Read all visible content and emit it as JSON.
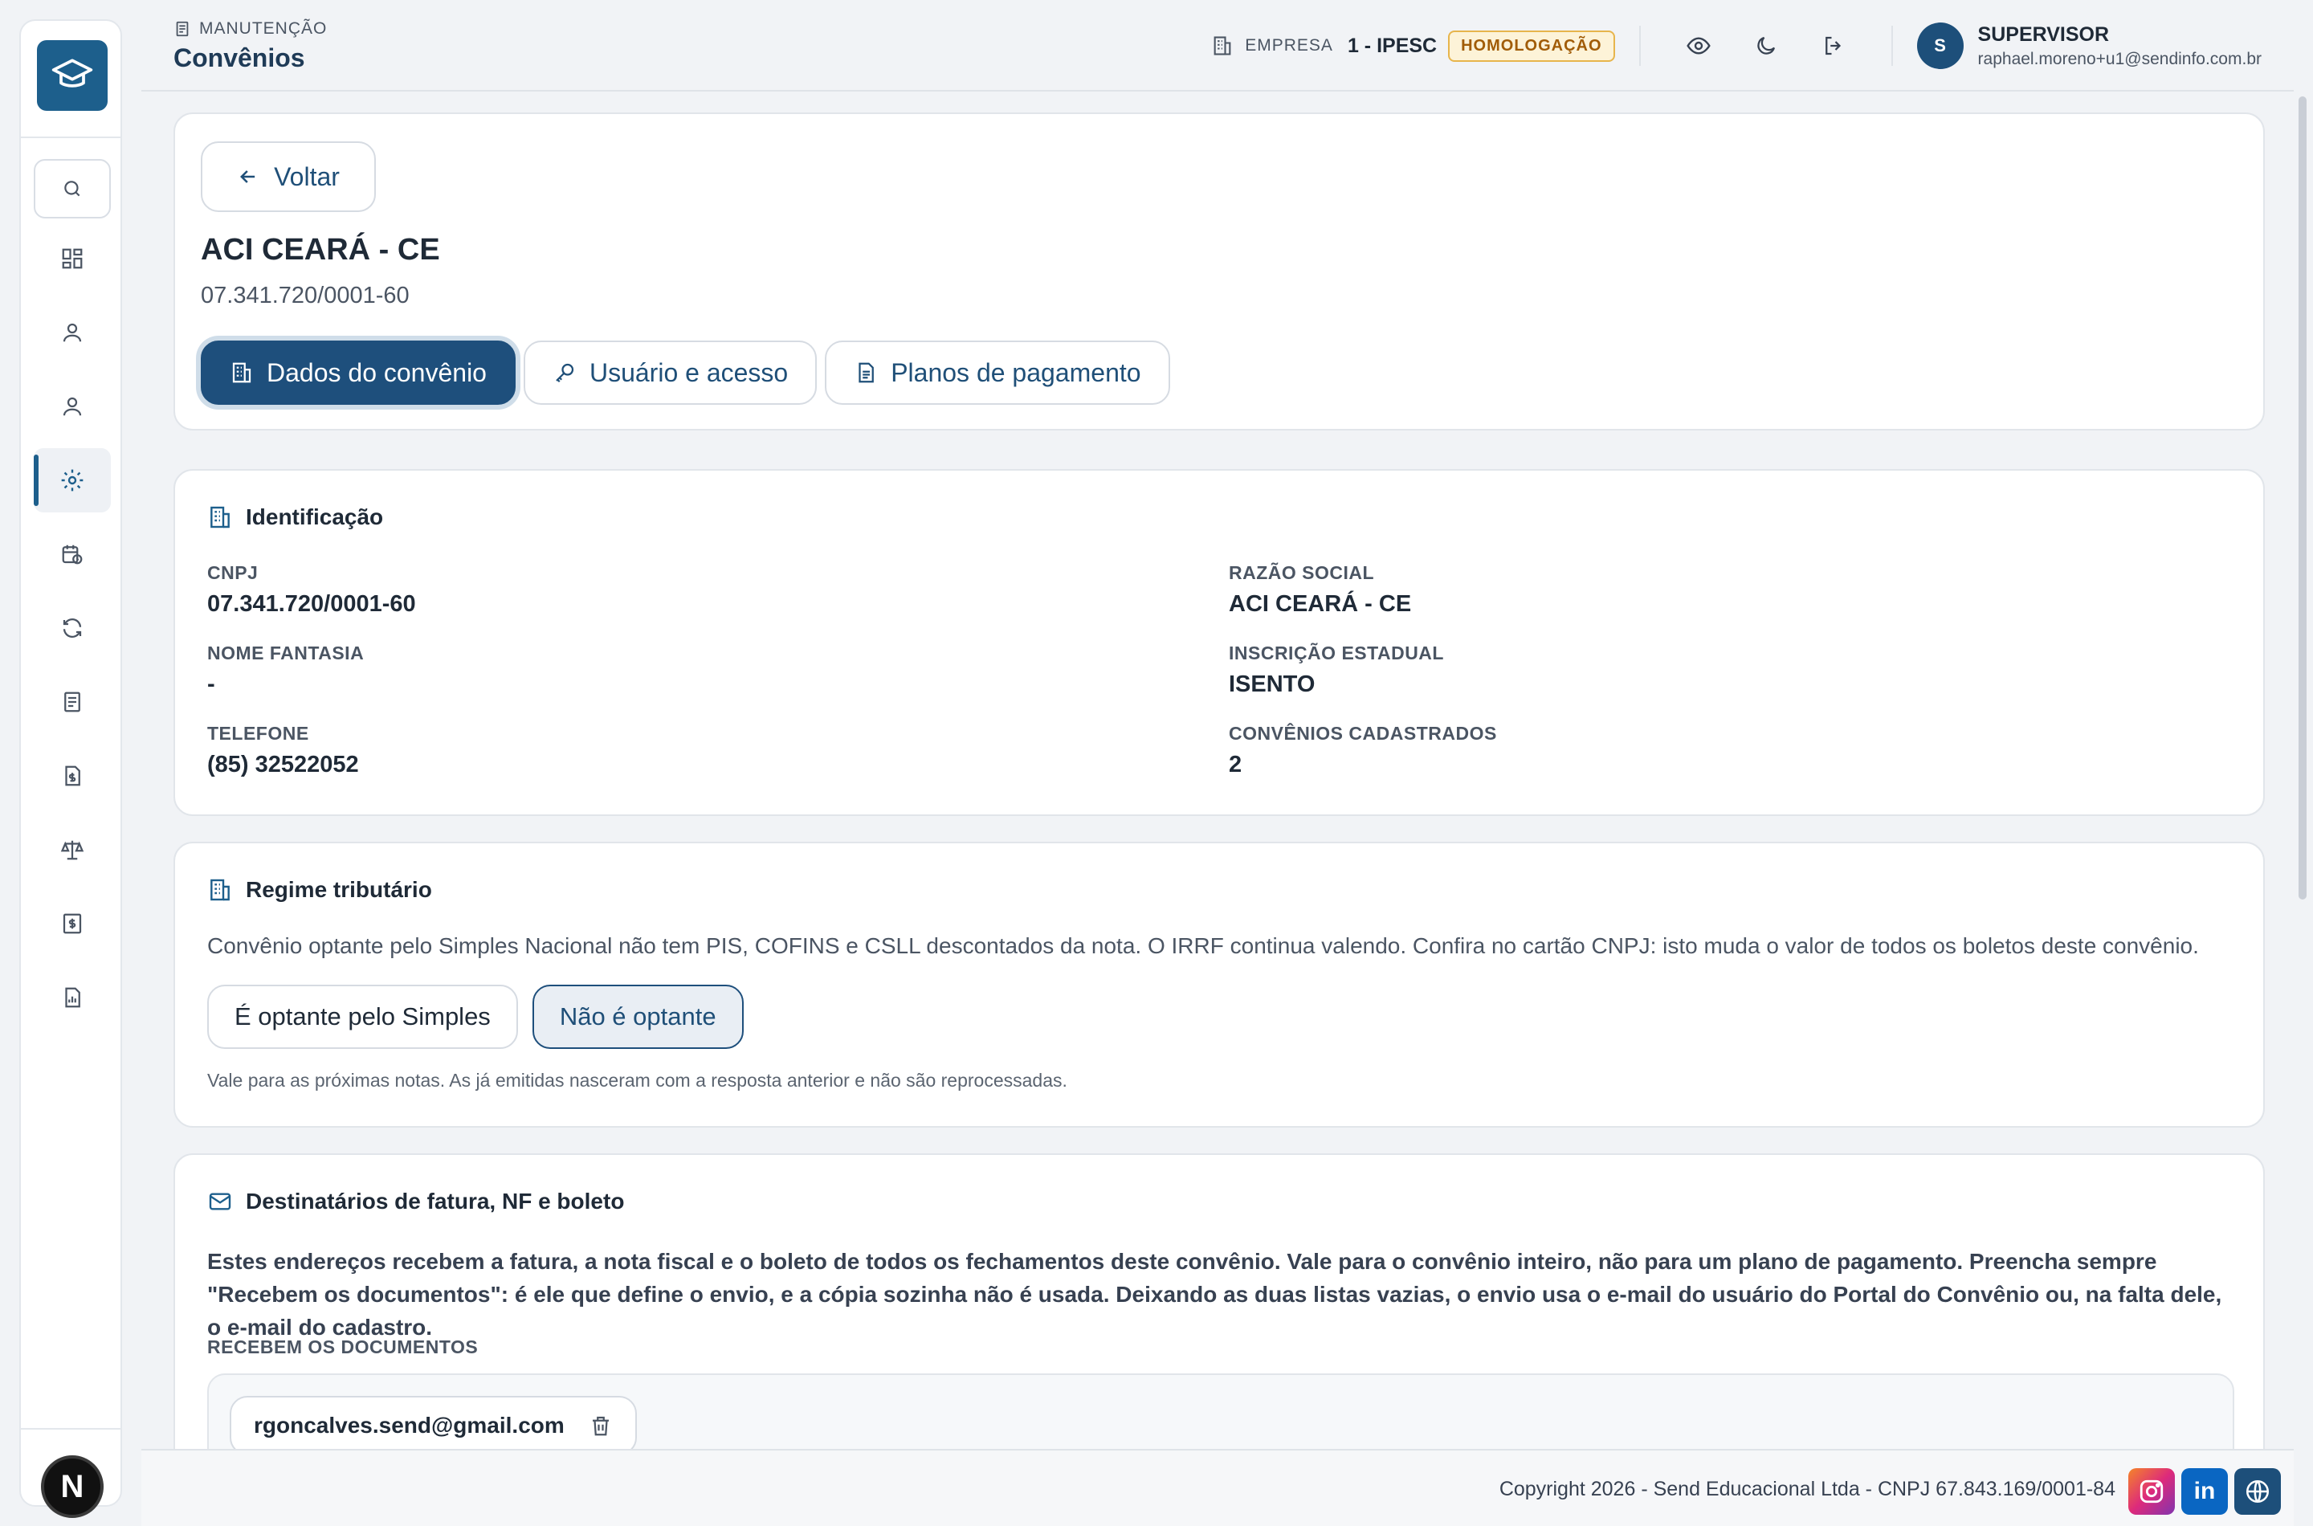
{
  "header": {
    "breadcrumb": "MANUTENÇÃO",
    "title": "Convênios",
    "empresa_label": "EMPRESA",
    "empresa_value": "1 - IPESC",
    "env_badge": "HOMOLOGAÇÃO",
    "user_initial": "S",
    "user_role": "SUPERVISOR",
    "user_email": "raphael.moreno+u1@sendinfo.com.br"
  },
  "sidebar": {
    "items": [
      {
        "icon": "dashboard-icon"
      },
      {
        "icon": "user-icon"
      },
      {
        "icon": "user-icon"
      },
      {
        "icon": "gear-icon",
        "active": true
      },
      {
        "icon": "calendar-clock-icon"
      },
      {
        "icon": "refresh-icon"
      },
      {
        "icon": "document-icon"
      },
      {
        "icon": "file-dollar-icon"
      },
      {
        "icon": "scale-icon"
      },
      {
        "icon": "receipt-icon"
      },
      {
        "icon": "report-icon"
      }
    ],
    "bottom_badge": "N"
  },
  "main": {
    "back_label": "Voltar",
    "name": "ACI CEARÁ - CE",
    "cnpj": "07.341.720/0001-60",
    "tabs": [
      {
        "label": "Dados do convênio",
        "active": true
      },
      {
        "label": "Usuário e acesso"
      },
      {
        "label": "Planos de pagamento"
      }
    ]
  },
  "identificacao": {
    "title": "Identificação",
    "fields": {
      "cnpj_label": "CNPJ",
      "cnpj_value": "07.341.720/0001-60",
      "razao_label": "RAZÃO SOCIAL",
      "razao_value": "ACI CEARÁ - CE",
      "fantasia_label": "NOME FANTASIA",
      "fantasia_value": "-",
      "ie_label": "INSCRIÇÃO ESTADUAL",
      "ie_value": "ISENTO",
      "telefone_label": "TELEFONE",
      "telefone_value": "(85) 32522052",
      "convenios_label": "CONVÊNIOS CADASTRADOS",
      "convenios_value": "2"
    }
  },
  "regime": {
    "title": "Regime tributário",
    "description": "Convênio optante pelo Simples Nacional não tem PIS, COFINS e CSLL descontados da nota. O IRRF continua valendo. Confira no cartão CNPJ: isto muda o valor de todos os boletos deste convênio.",
    "option_yes": "É optante pelo Simples",
    "option_no": "Não é optante",
    "selected": "option_no",
    "note": "Vale para as próximas notas. As já emitidas nasceram com a resposta anterior e não são reprocessadas."
  },
  "destinatarios": {
    "title": "Destinatários de fatura, NF e boleto",
    "description": "Estes endereços recebem a fatura, a nota fiscal e o boleto de todos os fechamentos deste convênio. Vale para o convênio inteiro, não para um plano de pagamento. Preencha sempre \"Recebem os documentos\": é ele que define o envio, e a cópia sozinha não é usada. Deixando as duas listas vazias, o envio usa o e-mail do usuário do Portal do Convênio ou, na falta dele, o e-mail do cadastro.",
    "list_label": "RECEBEM OS DOCUMENTOS",
    "emails": [
      "rgoncalves.send@gmail.com"
    ]
  },
  "footer": {
    "copyright": "Copyright 2026 - Send Educacional Ltda - CNPJ 67.843.169/0001-84",
    "linkedin": "in"
  },
  "colors": {
    "primary": "#1e4f7c",
    "badge_bg": "#fdf3d8",
    "badge_text": "#a15c07"
  }
}
